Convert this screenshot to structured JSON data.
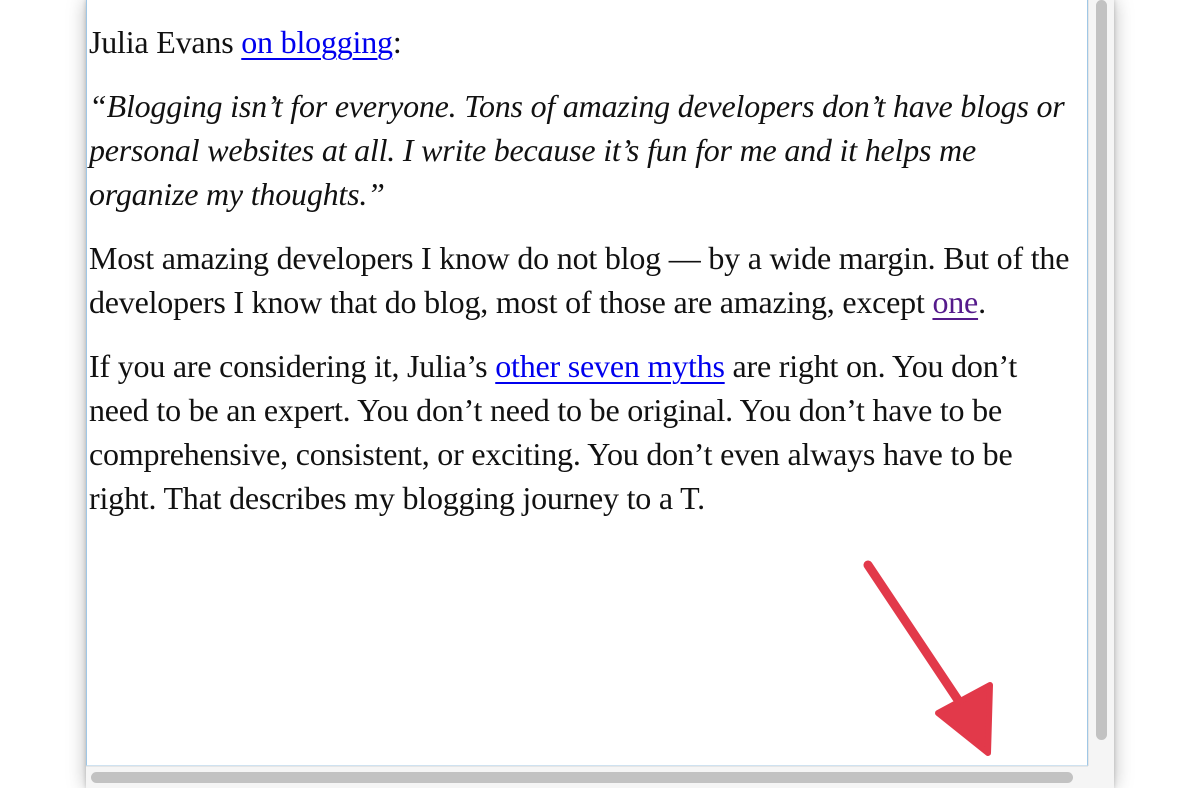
{
  "article": {
    "p1": {
      "lead": "Julia Evans ",
      "link": "on blogging",
      "tail": ":"
    },
    "quote": "“Blogging isn’t for everyone. Tons of amazing developers don’t have blogs or personal websites at all. I write because it’s fun for me and it helps me organize my thoughts.”",
    "p3": {
      "lead": "Most amazing developers I know do not blog — by a wide margin. But of the developers I know that do blog, most of those are amazing, except ",
      "link": "one",
      "tail": "."
    },
    "p4": {
      "lead": "If you are considering it, Julia’s ",
      "link": "other seven myths",
      "tail": " are right on. You don’t need to be an expert. You don’t need to be original. You don’t have to be comprehensive, consistent, or exciting. You don’t even always have to be right. That describes my blogging journey to a T."
    }
  },
  "colors": {
    "link": "#0000ee",
    "visited_link": "#551a8b",
    "annotation": "#e2394a",
    "scroll_thumb": "#c2c2c2"
  },
  "annotation": {
    "icon": "red-arrow-pointing-down-right"
  }
}
